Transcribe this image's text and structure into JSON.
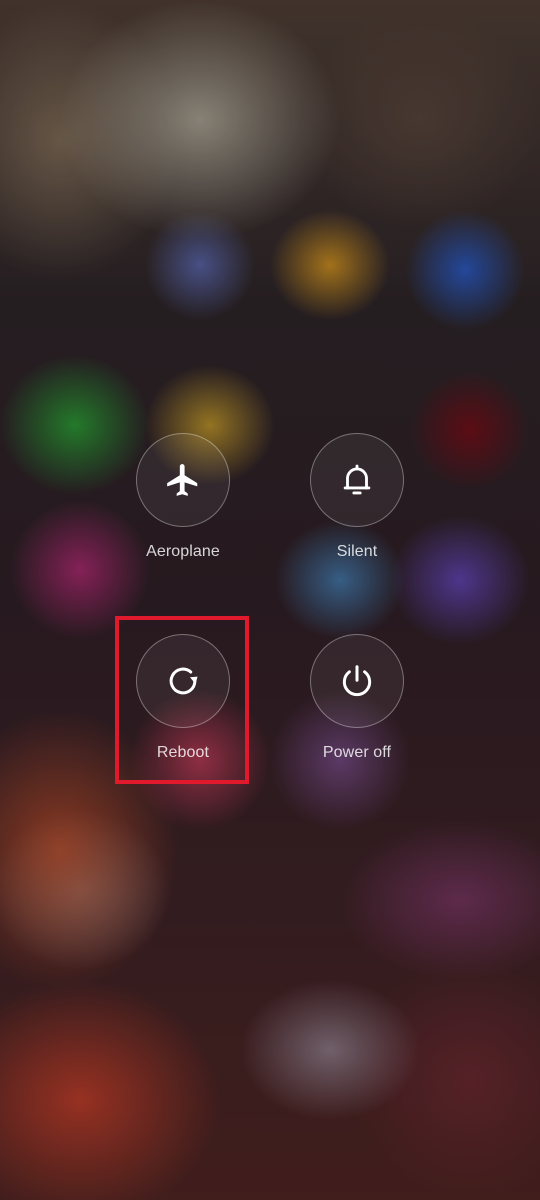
{
  "power_menu": {
    "actions": [
      {
        "id": "aeroplane",
        "label": "Aeroplane",
        "icon": "airplane-icon"
      },
      {
        "id": "silent",
        "label": "Silent",
        "icon": "bell-icon"
      },
      {
        "id": "reboot",
        "label": "Reboot",
        "icon": "reboot-icon"
      },
      {
        "id": "power_off",
        "label": "Power off",
        "icon": "power-icon"
      }
    ]
  },
  "annotation": {
    "highlight_color": "#e0192d",
    "highlighted_action": "reboot"
  },
  "colors": {
    "label_text": "#ffffff",
    "button_border": "rgba(255,255,255,0.35)"
  }
}
